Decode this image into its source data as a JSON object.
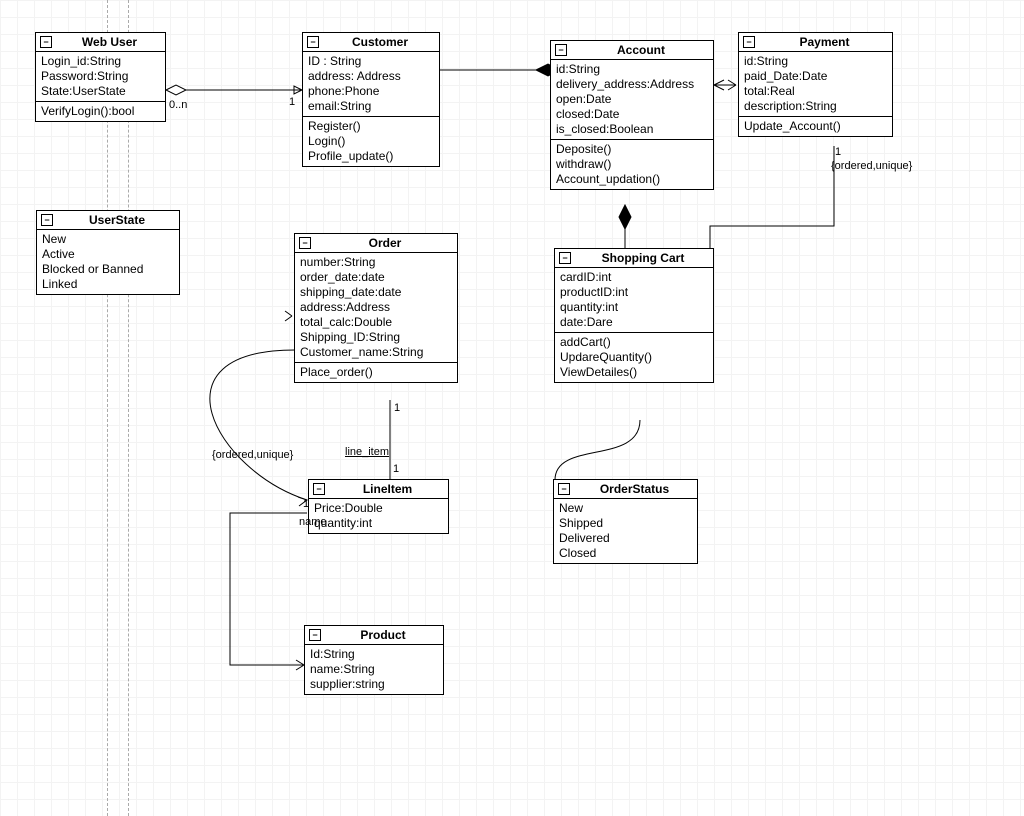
{
  "classes": {
    "webuser": {
      "title": "Web User",
      "attrs": [
        "Login_id:String",
        "Password:String",
        "State:UserState"
      ],
      "ops": [
        "VerifyLogin():bool"
      ]
    },
    "customer": {
      "title": "Customer",
      "attrs": [
        "ID : String",
        "address: Address",
        "phone:Phone",
        "email:String"
      ],
      "ops": [
        "Register()",
        "Login()",
        "Profile_update()"
      ]
    },
    "account": {
      "title": "Account",
      "attrs": [
        "id:String",
        "delivery_address:Address",
        "open:Date",
        "closed:Date",
        "is_closed:Boolean"
      ],
      "ops": [
        "Deposite()",
        "withdraw()",
        "Account_updation()"
      ]
    },
    "payment": {
      "title": "Payment",
      "attrs": [
        "id:String",
        "paid_Date:Date",
        "total:Real",
        "description:String"
      ],
      "ops": [
        "Update_Account()"
      ]
    },
    "userstate": {
      "title": "UserState",
      "attrs": [
        "New",
        "Active",
        "Blocked or Banned",
        "Linked"
      ],
      "ops": []
    },
    "order": {
      "title": "Order",
      "attrs": [
        "number:String",
        "order_date:date",
        "shipping_date:date",
        "address:Address",
        "total_calc:Double",
        "Shipping_ID:String",
        "Customer_name:String"
      ],
      "ops": [
        "Place_order()"
      ]
    },
    "shoppingcart": {
      "title": "Shopping Cart",
      "attrs": [
        "cardID:int",
        "productID:int",
        "quantity:int",
        "date:Dare"
      ],
      "ops": [
        "addCart()",
        "UpdareQuantity()",
        "ViewDetailes()"
      ]
    },
    "lineitem": {
      "title": "LineItem",
      "attrs": [
        "Price:Double",
        "quantity:int"
      ],
      "ops": []
    },
    "orderstatus": {
      "title": "OrderStatus",
      "attrs": [
        "New",
        "Shipped",
        "Delivered",
        "Closed"
      ],
      "ops": []
    },
    "product": {
      "title": "Product",
      "attrs": [
        "Id:String",
        "name:String",
        "supplier:string"
      ],
      "ops": []
    }
  },
  "annots": {
    "mult_webuser": "0..n",
    "mult_customer": "1",
    "mult_order": "1",
    "mult_lineitem_top": "1",
    "mult_lineitem_left": "1",
    "mult_payment": "1",
    "constraint1": "{ordered,unique}",
    "constraint2": "{ordered,unique}",
    "label_lineitem": "line_item",
    "label_name": "name"
  }
}
